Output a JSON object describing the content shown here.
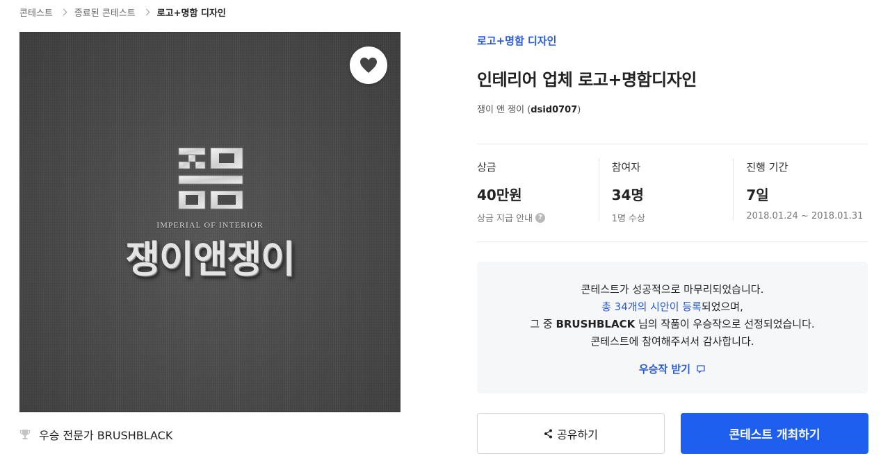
{
  "breadcrumb": {
    "items": [
      "콘테스트",
      "종료된 콘테스트",
      "로고+명함 디자인"
    ]
  },
  "hero": {
    "logo_subtitle": "IMPERIAL OF INTERIOR",
    "logo_name": "쟁이앤쟁이",
    "like_icon": "heart-icon"
  },
  "winner": {
    "icon": "trophy-icon",
    "label": "우승 전문가 BRUSHBLACK"
  },
  "contest": {
    "category": "로고+명함 디자인",
    "title": "인테리어 업체 로고+명함디자인",
    "host_name": "쟁이 앤 쟁이 (",
    "host_id": "dsid0707",
    "host_close": ")"
  },
  "stats": [
    {
      "label": "상금",
      "value": "40만원",
      "sub": "상금 지급 안내",
      "help": "?"
    },
    {
      "label": "참여자",
      "value": "34명",
      "sub": "1명 수상"
    },
    {
      "label": "진행 기간",
      "value": "7일",
      "sub": "2018.01.24 ~ 2018.01.31"
    }
  ],
  "notice": {
    "line1": "콘테스트가 성공적으로 마무리되었습니다.",
    "line2_link": "총 34개의 시안이 등록",
    "line2_rest": "되었으며,",
    "line3_pre": "그 중 ",
    "line3_name": "BRUSHBLACK",
    "line3_rest": " 님의 작품이 우승작으로 선정되었습니다.",
    "line4": "콘테스트에 참여해주셔서 감사합니다.",
    "link_label": "우승작 받기",
    "link_icon": "chat-bubble-icon"
  },
  "actions": {
    "share_label": "공유하기",
    "share_icon": "share-icon",
    "host_label": "콘테스트 개최하기"
  },
  "colors": {
    "accent": "#2a5bd7",
    "primary_button": "#1f5ff0",
    "notice_bg": "#f6f7f9"
  }
}
